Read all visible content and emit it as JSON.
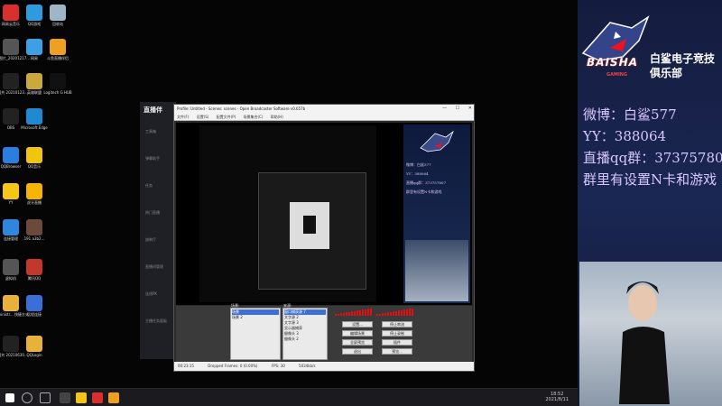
{
  "desktop_icons": [
    {
      "label": "网易云音乐",
      "color": "#d9302f"
    },
    {
      "label": "QQ游戏",
      "color": "#2e9be0"
    },
    {
      "label": "回收站",
      "color": "#9fb6c9"
    },
    {
      "label": "微信图片_20201217...",
      "color": "#555555"
    },
    {
      "label": "网易",
      "color": "#3da0e6"
    },
    {
      "label": "斗鱼直播伴侣",
      "color": "#f0a020"
    },
    {
      "label": "中国共 20210123...",
      "color": "#222222"
    },
    {
      "label": "英雄联盟",
      "color": "#c9a93c"
    },
    {
      "label": "Logitech G HUB",
      "color": "#111111"
    },
    {
      "label": "OBS",
      "color": "#222222"
    },
    {
      "label": "Microsoft Edge",
      "color": "#1f8ad2"
    },
    {
      "label": "QQBrowser",
      "color": "#2a7de1"
    },
    {
      "label": "QQ音乐",
      "color": "#f1c40f"
    },
    {
      "label": "YY",
      "color": "#f5c518"
    },
    {
      "label": "虎牙直播",
      "color": "#f5b400"
    },
    {
      "label": "连接管理",
      "color": "#2e86de"
    },
    {
      "label": "191 a3b2...",
      "color": "#6b4a3a"
    },
    {
      "label": "虚拟机",
      "color": "#555555"
    },
    {
      "label": "腾讯QQ",
      "color": "#c0392b"
    },
    {
      "label": "Administr... 快捷方式",
      "color": "#e8b23a"
    },
    {
      "label": "远程连接",
      "color": "#3a6fd8"
    },
    {
      "label": "中国共 20210630...",
      "color": "#222222"
    },
    {
      "label": "QQLogin",
      "color": "#e8b23a"
    }
  ],
  "taskbar": {
    "time": "18:52",
    "date": "2021/8/11"
  },
  "app_bg": {
    "logo": "直播伴",
    "sidebar": [
      "工具箱",
      "弹幕助手",
      "任务",
      "热门直播",
      "放映厅",
      "直播间管理",
      "连线PK",
      "主播任务面板"
    ]
  },
  "obs": {
    "title": "Profile: Untitled - Scenes: scenes - Open Broadcaster Software v0.657b",
    "menu": [
      "文件(F)",
      "设置(S)",
      "配置文件(P)",
      "场景集合(C)",
      "帮助(H)"
    ],
    "scenes_header": "场景:",
    "scenes": [
      "场景",
      "场景 2"
    ],
    "sources_header": "来源:",
    "sources": [
      "窗口捕获源 7",
      "文字源 2",
      "文字源 3",
      "显示器捕获",
      "摄像头 3",
      "摄像头 2"
    ],
    "buttons": [
      "设置...",
      "停止串流",
      "编辑场景",
      "停止录制",
      "全屏预览",
      "插件",
      "退出",
      "预览..."
    ],
    "status": [
      "00:23:15",
      "Dropped Frames: 0 (0.00%)",
      "FPS: 30",
      "5034kb/s"
    ]
  },
  "preview_panel_text": [
    "微博：白鲨577",
    "YY：388064",
    "直播qq群：373757807",
    "群里有设置N卡和游戏"
  ],
  "overlay": {
    "logo_text": "BAISHA",
    "logo_sub": "GAMING",
    "brand_name_line1": "白鲨电子竞技",
    "brand_name_line2": "俱乐部",
    "weibo": "微博：白鲨577",
    "yy": " YY：388064",
    "qq_group": "直播qq群：373757807",
    "note": "群里有设置N卡和游戏"
  },
  "colors": {
    "accent_red": "#d11111",
    "overlay_bg": "#1b2753",
    "info_text": "#d8c6ff"
  }
}
